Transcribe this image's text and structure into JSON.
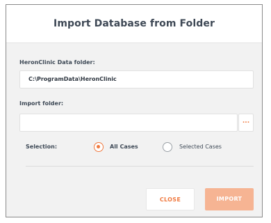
{
  "dialog": {
    "title": "Import Database from Folder",
    "data_folder_label": "HeronClinic Data folder:",
    "data_folder_value": "C:\\ProgramData\\HeronClinic",
    "import_folder_label": "Import folder:",
    "import_folder_value": "",
    "browse_label": "...",
    "selection_label": "Selection:",
    "options": [
      {
        "label": "All Cases",
        "selected": true
      },
      {
        "label": "Selected Cases",
        "selected": false
      }
    ],
    "close_label": "CLOSE",
    "import_label": "IMPORT"
  },
  "colors": {
    "accent": "#f07a40",
    "accent_disabled": "#f6b493"
  }
}
